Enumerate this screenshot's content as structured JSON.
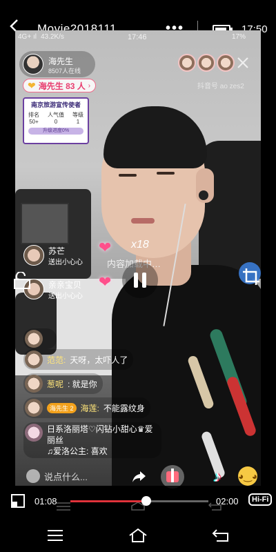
{
  "player": {
    "title": "Movie2018111…",
    "more": "•••",
    "clock": "17:50"
  },
  "stream": {
    "status_left": [
      "4G+ ıl",
      "43.2K/s"
    ],
    "status_time": "17:46",
    "status_right": "17%",
    "host": {
      "name": "海先生",
      "viewers": "8507人在线"
    },
    "sub_id": "抖音号 ao zes2",
    "fans_pill": "海先生 83 人",
    "rank_card": {
      "title": "南京旅游宣传使者",
      "headers": [
        "排名",
        "人气值",
        "等级"
      ],
      "values": [
        "50+",
        "0",
        "1"
      ],
      "progress": "升级进度0%"
    },
    "gift_count": "x18",
    "loading": "内容加载中…",
    "gift_senders": [
      {
        "name": "苏芒",
        "gift": "送出小心心"
      },
      {
        "name": "亲亲宝贝",
        "gift": "送出小心心"
      }
    ],
    "chats": [
      {
        "name": "",
        "text": ""
      },
      {
        "name": "范范:",
        "text": "天呀，太吓人了"
      },
      {
        "name": "葱呢",
        "text": ": 就是你"
      },
      {
        "name": "海莲:",
        "text": "不能露纹身",
        "badge": "海先生 2"
      }
    ],
    "multi_line": [
      "日系洛丽塔♡闪钻小甜心♛爱丽丝",
      "♫爱洛公主: 喜欢"
    ],
    "comment_placeholder": "说点什么..."
  },
  "playback": {
    "current": "01:08",
    "total": "02:00",
    "progress": 0.55,
    "hifi": "Hi-Fi"
  },
  "icons": [
    "back-icon",
    "battery-icon",
    "close-icon",
    "pip-icon",
    "pause-icon",
    "crop-icon",
    "share-icon",
    "gift-icon",
    "tiktok-icon",
    "emoji-icon",
    "mini-window-icon",
    "menu-icon",
    "home-icon",
    "return-icon"
  ]
}
